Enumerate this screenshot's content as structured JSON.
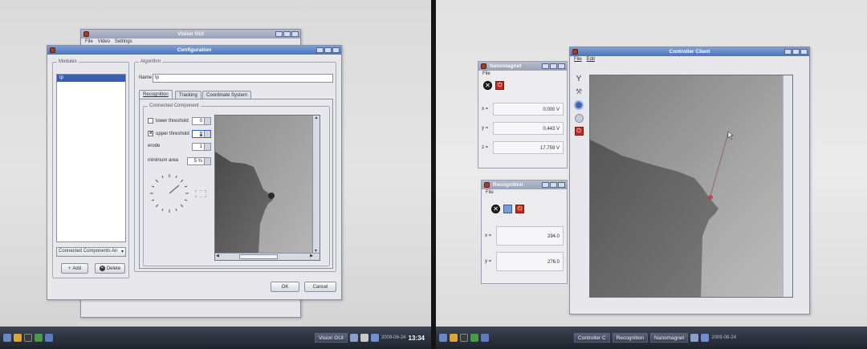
{
  "left_screen": {
    "back_window": {
      "title": "Vision GUI",
      "menu": [
        "File",
        "Video",
        "Settings"
      ]
    },
    "config_window": {
      "title": "Configuration",
      "modules_label": "Modules",
      "modules_list": [
        "tp"
      ],
      "module_type_select": "Connected Components An",
      "add_label": "Add",
      "delete_label": "Delete",
      "algorithm_label": "Algorithm",
      "name_label": "Name",
      "name_value": "tp",
      "tabs": [
        "Recognition",
        "Tracking",
        "Coordinate System"
      ],
      "group_label": "Connected Component",
      "params": [
        {
          "label": "lower threshold",
          "value": "0",
          "checked": false
        },
        {
          "label": "upper threshold",
          "value": "4",
          "checked": true
        },
        {
          "label": "erode",
          "value": "1"
        },
        {
          "label": "minimum area",
          "value": "5 %"
        }
      ],
      "ok_label": "OK",
      "cancel_label": "Cancel"
    },
    "taskbar": {
      "item": "Vision GUI",
      "date": "2009-08-24",
      "time": "13:34"
    }
  },
  "right_screen": {
    "controller_window": {
      "title": "Controller Client",
      "menu": [
        "File",
        "Edit"
      ],
      "tools": [
        "antenna-icon",
        "wrench-icon",
        "camera-icon",
        "disc-icon",
        "power-icon"
      ]
    },
    "nanomagnet_window": {
      "title": "Nanomagnet",
      "menu": [
        "File"
      ],
      "rows": [
        {
          "label": "x =",
          "value": "0.000 V"
        },
        {
          "label": "y =",
          "value": "0.443 V"
        },
        {
          "label": "z =",
          "value": "17.759 V"
        }
      ]
    },
    "recognition_window": {
      "title": "Recognition",
      "menu": [
        "File"
      ],
      "rows": [
        {
          "label": "x =",
          "value": "294.0"
        },
        {
          "label": "y =",
          "value": "276.0"
        }
      ]
    },
    "taskbar": {
      "items": [
        "Controller C",
        "Recognition",
        "Nanomagnet"
      ],
      "date": "2009-08-24"
    }
  },
  "colors": {
    "titlebar": "#4e73bd",
    "close_red": "#c72d1e"
  }
}
